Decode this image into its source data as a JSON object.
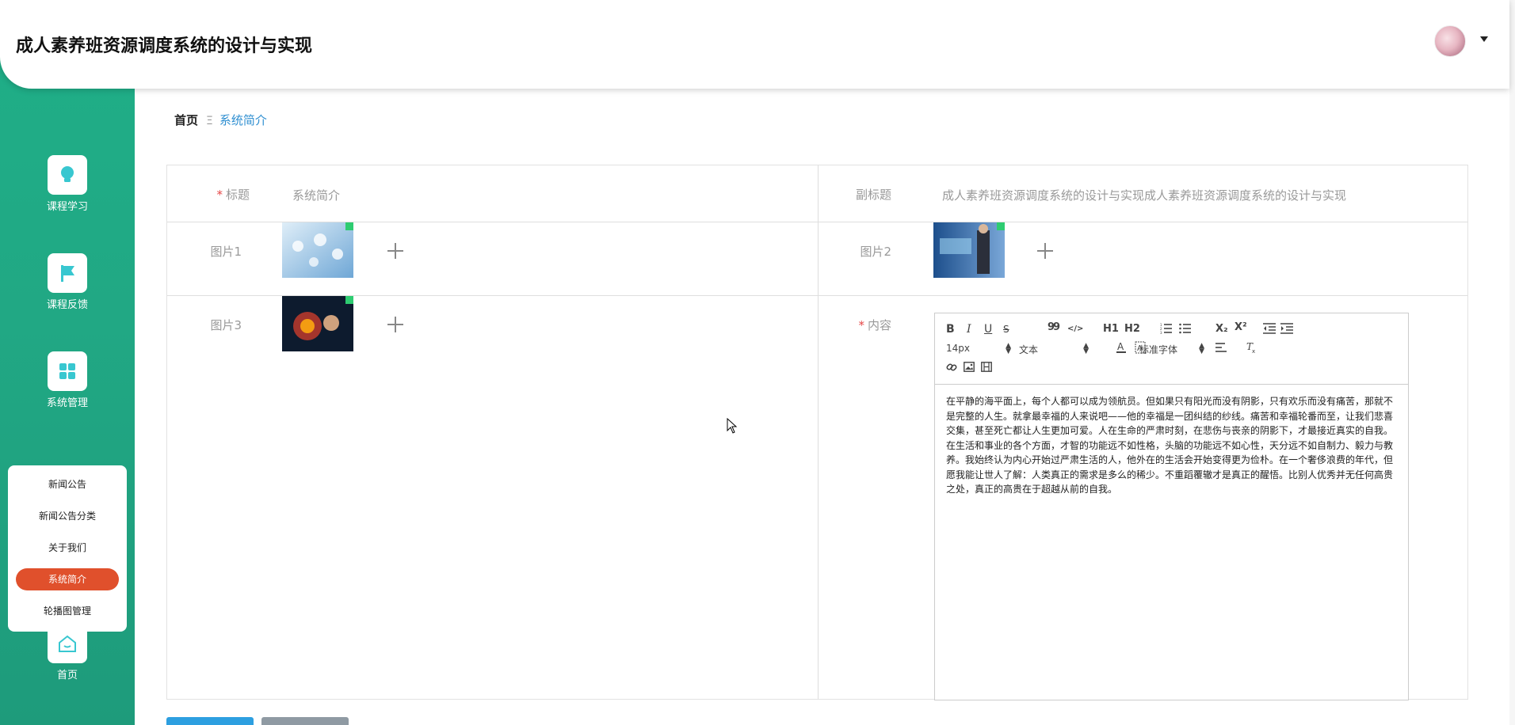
{
  "app": {
    "title": "成人素养班资源调度系统的设计与实现"
  },
  "header": {
    "avatar_icon": "user-avatar",
    "caret_icon": "caret-down-icon"
  },
  "sidebar": {
    "items": [
      {
        "label": "课程学习",
        "icon": "bulb-icon"
      },
      {
        "label": "课程反馈",
        "icon": "flag-icon"
      },
      {
        "label": "系统管理",
        "icon": "grid-icon"
      },
      {
        "label": "首页",
        "icon": "home-icon"
      }
    ],
    "submenu": [
      {
        "label": "新闻公告"
      },
      {
        "label": "新闻公告分类"
      },
      {
        "label": "关于我们"
      },
      {
        "label": "系统简介",
        "active": true
      },
      {
        "label": "轮播图管理"
      }
    ],
    "active_color": "#e0502c",
    "accent": "#1fae87"
  },
  "breadcrumb": {
    "home": "首页",
    "separator": "Ξ",
    "current": "系统简介"
  },
  "form": {
    "title_label": "标题",
    "title_value": "系统简介",
    "subtitle_label": "副标题",
    "subtitle_value": "成人素养班资源调度系统的设计与实现成人素养班资源调度系统的设计与实现",
    "pic1_label": "图片1",
    "pic2_label": "图片2",
    "pic3_label": "图片3",
    "content_label": "内容"
  },
  "editor": {
    "toolbar_row1": [
      "B",
      "I",
      "U",
      "S",
      "99",
      "</>",
      "H1",
      "H2",
      "ordered-list",
      "bullet-list",
      "X₂",
      "X²",
      "outdent",
      "indent"
    ],
    "font_size": "14px",
    "format": "文本",
    "font_family": "标准字体",
    "content": "在平静的海平面上，每个人都可以成为领航员。但如果只有阳光而没有阴影，只有欢乐而没有痛苦，那就不是完整的人生。就拿最幸福的人来说吧——他的幸福是一团纠结的纱线。痛苦和幸福轮番而至，让我们悲喜交集，甚至死亡都让人生更加可爱。人在生命的严肃时刻，在悲伤与丧亲的阴影下，才最接近真实的自我。在生活和事业的各个方面，才智的功能远不如性格，头脑的功能远不如心性，天分远不如自制力、毅力与教养。我始终认为内心开始过严肃生活的人，他外在的生活会开始变得更为俭朴。在一个奢侈浪费的年代，但愿我能让世人了解：人类真正的需求是多么的稀少。不重蹈覆辙才是真正的醒悟。比别人优秀并无任何高贵之处，真正的高贵在于超越从前的自我。"
  }
}
